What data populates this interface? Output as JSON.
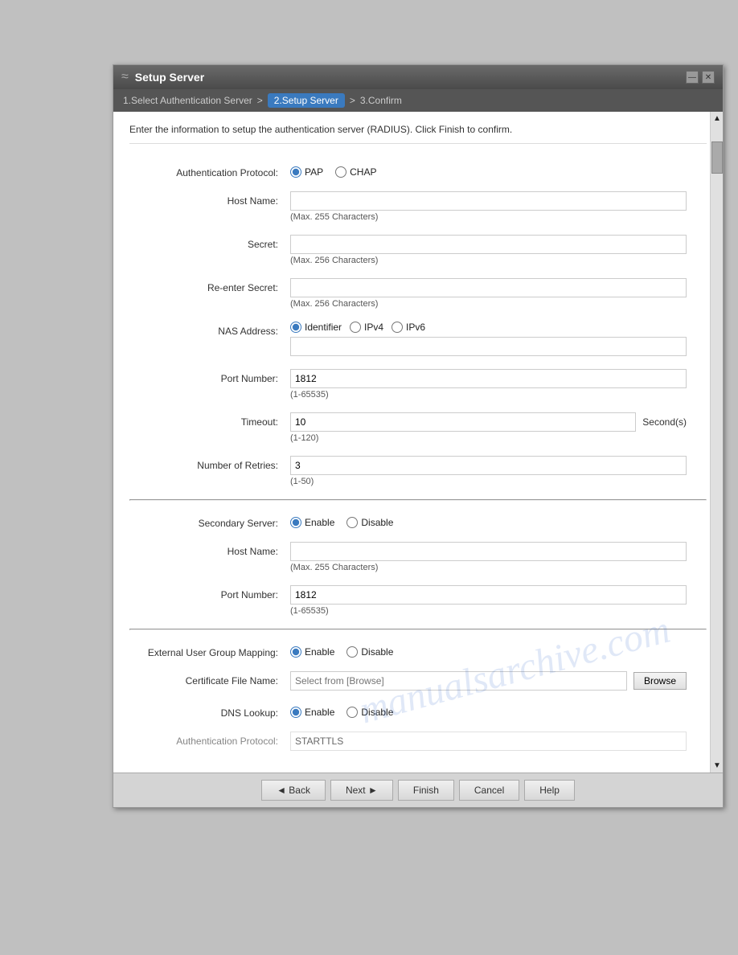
{
  "window": {
    "title": "Setup Server",
    "title_icon": "≈"
  },
  "breadcrumb": {
    "step1": "1.Select Authentication Server",
    "separator": ">",
    "step2": "2.Setup Server",
    "separator2": ">",
    "step3": "3.Confirm"
  },
  "description": "Enter the information to setup the authentication server (RADIUS). Click Finish to confirm.",
  "form": {
    "auth_protocol": {
      "label": "Authentication Protocol:",
      "pap_label": "PAP",
      "chap_label": "CHAP",
      "selected": "PAP"
    },
    "host_name": {
      "label": "Host Name:",
      "hint": "(Max. 255 Characters)",
      "value": ""
    },
    "secret": {
      "label": "Secret:",
      "hint": "(Max. 256 Characters)",
      "value": ""
    },
    "re_enter_secret": {
      "label": "Re-enter Secret:",
      "hint": "(Max. 256 Characters)",
      "value": ""
    },
    "nas_address": {
      "label": "NAS Address:",
      "identifier_label": "Identifier",
      "ipv4_label": "IPv4",
      "ipv6_label": "IPv6",
      "selected": "Identifier",
      "value": ""
    },
    "port_number": {
      "label": "Port Number:",
      "value": "1812",
      "hint": "(1-65535)"
    },
    "timeout": {
      "label": "Timeout:",
      "value": "10",
      "hint": "(1-120)",
      "suffix": "Second(s)"
    },
    "number_of_retries": {
      "label": "Number of Retries:",
      "value": "3",
      "hint": "(1-50)"
    },
    "secondary_server": {
      "label": "Secondary Server:",
      "enable_label": "Enable",
      "disable_label": "Disable",
      "selected": "Enable"
    },
    "secondary_host_name": {
      "label": "Host Name:",
      "hint": "(Max. 255 Characters)",
      "value": ""
    },
    "secondary_port_number": {
      "label": "Port Number:",
      "value": "1812",
      "hint": "(1-65535)"
    },
    "external_user_group": {
      "label": "External User Group Mapping:",
      "enable_label": "Enable",
      "disable_label": "Disable",
      "selected": "Enable"
    },
    "certificate_file": {
      "label": "Certificate File Name:",
      "placeholder": "Select from [Browse]",
      "browse_label": "Browse"
    },
    "dns_lookup": {
      "label": "DNS Lookup:",
      "enable_label": "Enable",
      "disable_label": "Disable",
      "selected": "Enable"
    },
    "auth_protocol_bottom": {
      "label": "Authentication Protocol:",
      "value": "STARTTLS"
    }
  },
  "buttons": {
    "back": "◄ Back",
    "next": "Next ►",
    "finish": "Finish",
    "cancel": "Cancel",
    "help": "Help"
  },
  "scrollbar": {
    "arrow_up": "▲",
    "arrow_down": "▼"
  }
}
